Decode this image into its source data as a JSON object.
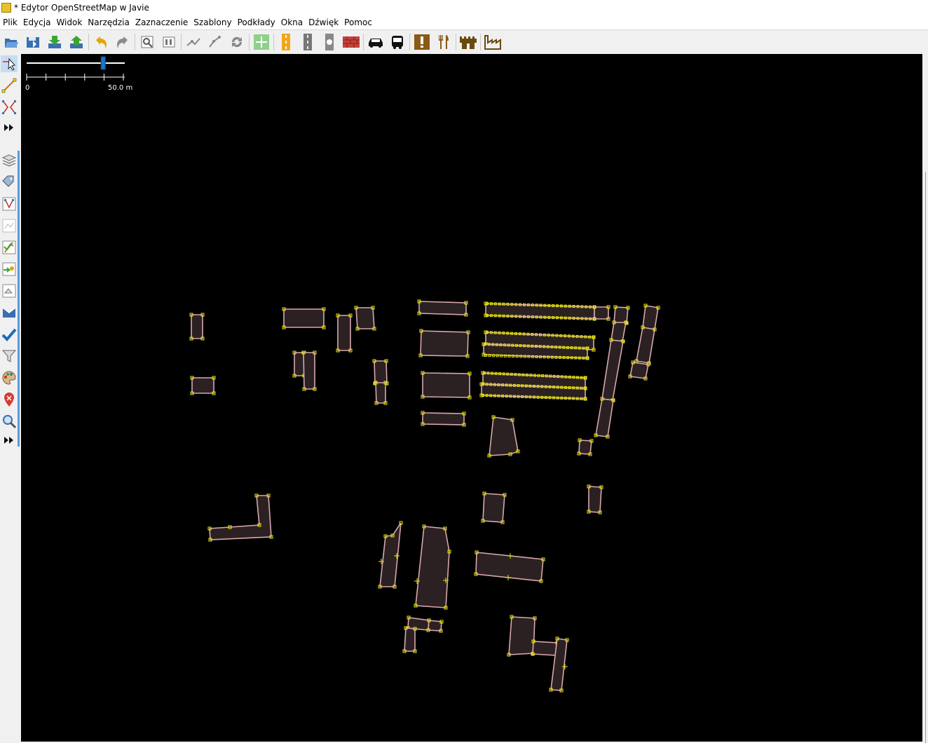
{
  "window": {
    "title": "* Edytor OpenStreetMap w Javie"
  },
  "menu": [
    "Plik",
    "Edycja",
    "Widok",
    "Narzędzia",
    "Zaznaczenie",
    "Szablony",
    "Podkłady",
    "Okna",
    "Dźwięk",
    "Pomoc"
  ],
  "toolbar_icons": [
    "open-icon",
    "save-icon",
    "download-icon",
    "upload-icon",
    "undo-icon",
    "redo-icon",
    "preferences-icon",
    "presets-icon",
    "split-way-icon",
    "combine-way-icon",
    "refresh-icon",
    "map-paint-icon",
    "road-preset-icon",
    "railway-preset-icon",
    "rail-signal-icon",
    "wall-preset-icon",
    "car-preset-icon",
    "bus-preset-icon",
    "warning-preset-icon",
    "restaurant-preset-icon",
    "castle-preset-icon",
    "industrial-preset-icon"
  ],
  "sidebar_icons": [
    "select-tool-icon",
    "draw-tool-icon",
    "improve-way-icon",
    "more-tools-icon",
    "layers-icon",
    "tags-icon",
    "relations-icon",
    "history-icon",
    "validation-icon",
    "changeset-icon",
    "conflict-icon",
    "merge-icon",
    "todo-icon",
    "filter-icon",
    "map-style-icon",
    "notes-icon",
    "search-icon",
    "more-dialogs-icon"
  ],
  "scale": {
    "left_label": "0",
    "right_label": "50.0 m",
    "zoom_fraction": 0.78
  },
  "colors": {
    "map_background": "#000000",
    "building_fill": "#2b2122",
    "building_outline": "#d8a8ac",
    "node": "#e8e800",
    "accent": "#1e73c8"
  }
}
